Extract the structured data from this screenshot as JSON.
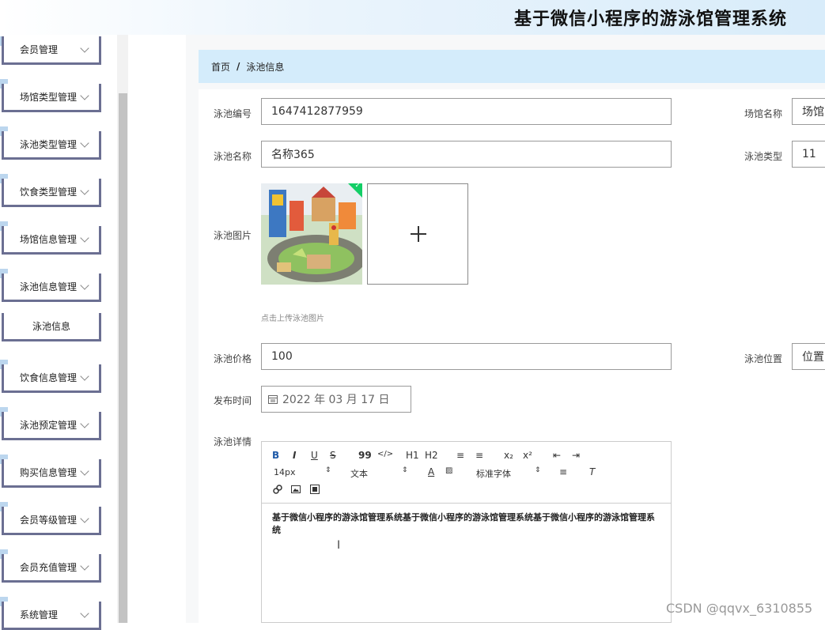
{
  "app": {
    "title": "基于微信小程序的游泳馆管理系统"
  },
  "sidebar": {
    "items": [
      {
        "label": "会员管理"
      },
      {
        "label": "场馆类型管理"
      },
      {
        "label": "泳池类型管理"
      },
      {
        "label": "饮食类型管理"
      },
      {
        "label": "场馆信息管理"
      },
      {
        "label": "泳池信息管理"
      },
      {
        "label": "泳池信息"
      },
      {
        "label": "饮食信息管理"
      },
      {
        "label": "泳池预定管理"
      },
      {
        "label": "购买信息管理"
      },
      {
        "label": "会员等级管理"
      },
      {
        "label": "会员充值管理"
      },
      {
        "label": "系统管理"
      }
    ]
  },
  "breadcrumb": {
    "home": "首页",
    "sep": "/",
    "current": "泳池信息"
  },
  "form": {
    "pool_no": {
      "label": "泳池编号",
      "value": "1647412877959"
    },
    "venue_name": {
      "label": "场馆名称",
      "value": "场馆"
    },
    "pool_name": {
      "label": "泳池名称",
      "value": "名称365"
    },
    "pool_type": {
      "label": "泳池类型",
      "value": "11"
    },
    "pool_image": {
      "label": "泳池图片",
      "hint": "点击上传泳池图片"
    },
    "pool_price": {
      "label": "泳池价格",
      "value": "100"
    },
    "pool_location": {
      "label": "泳池位置",
      "value": "位置"
    },
    "publish_time": {
      "label": "发布时间",
      "value": "2022 年 03 月 17 日"
    },
    "pool_detail": {
      "label": "泳池详情"
    }
  },
  "editor": {
    "toolbar": {
      "bold": "B",
      "italic": "I",
      "underline": "U",
      "strike": "S",
      "quote": "99",
      "code": "</>",
      "h1": "H1",
      "h2": "H2",
      "ol": "≡",
      "ul": "≡",
      "sub": "x₂",
      "sup": "x²",
      "font_size": "14px",
      "text_style": "文本",
      "font_family": "标准字体"
    },
    "content": "基于微信小程序的游泳馆管理系统基于微信小程序的游泳馆管理系统基于微信小程序的游泳馆管理系统"
  },
  "watermark": "CSDN @qqvx_6310855",
  "colors": {
    "breadcrumb_bg": "#d4ecfb",
    "menu_border": "#6b6f92",
    "bold_blue": "#1f5aa8"
  }
}
